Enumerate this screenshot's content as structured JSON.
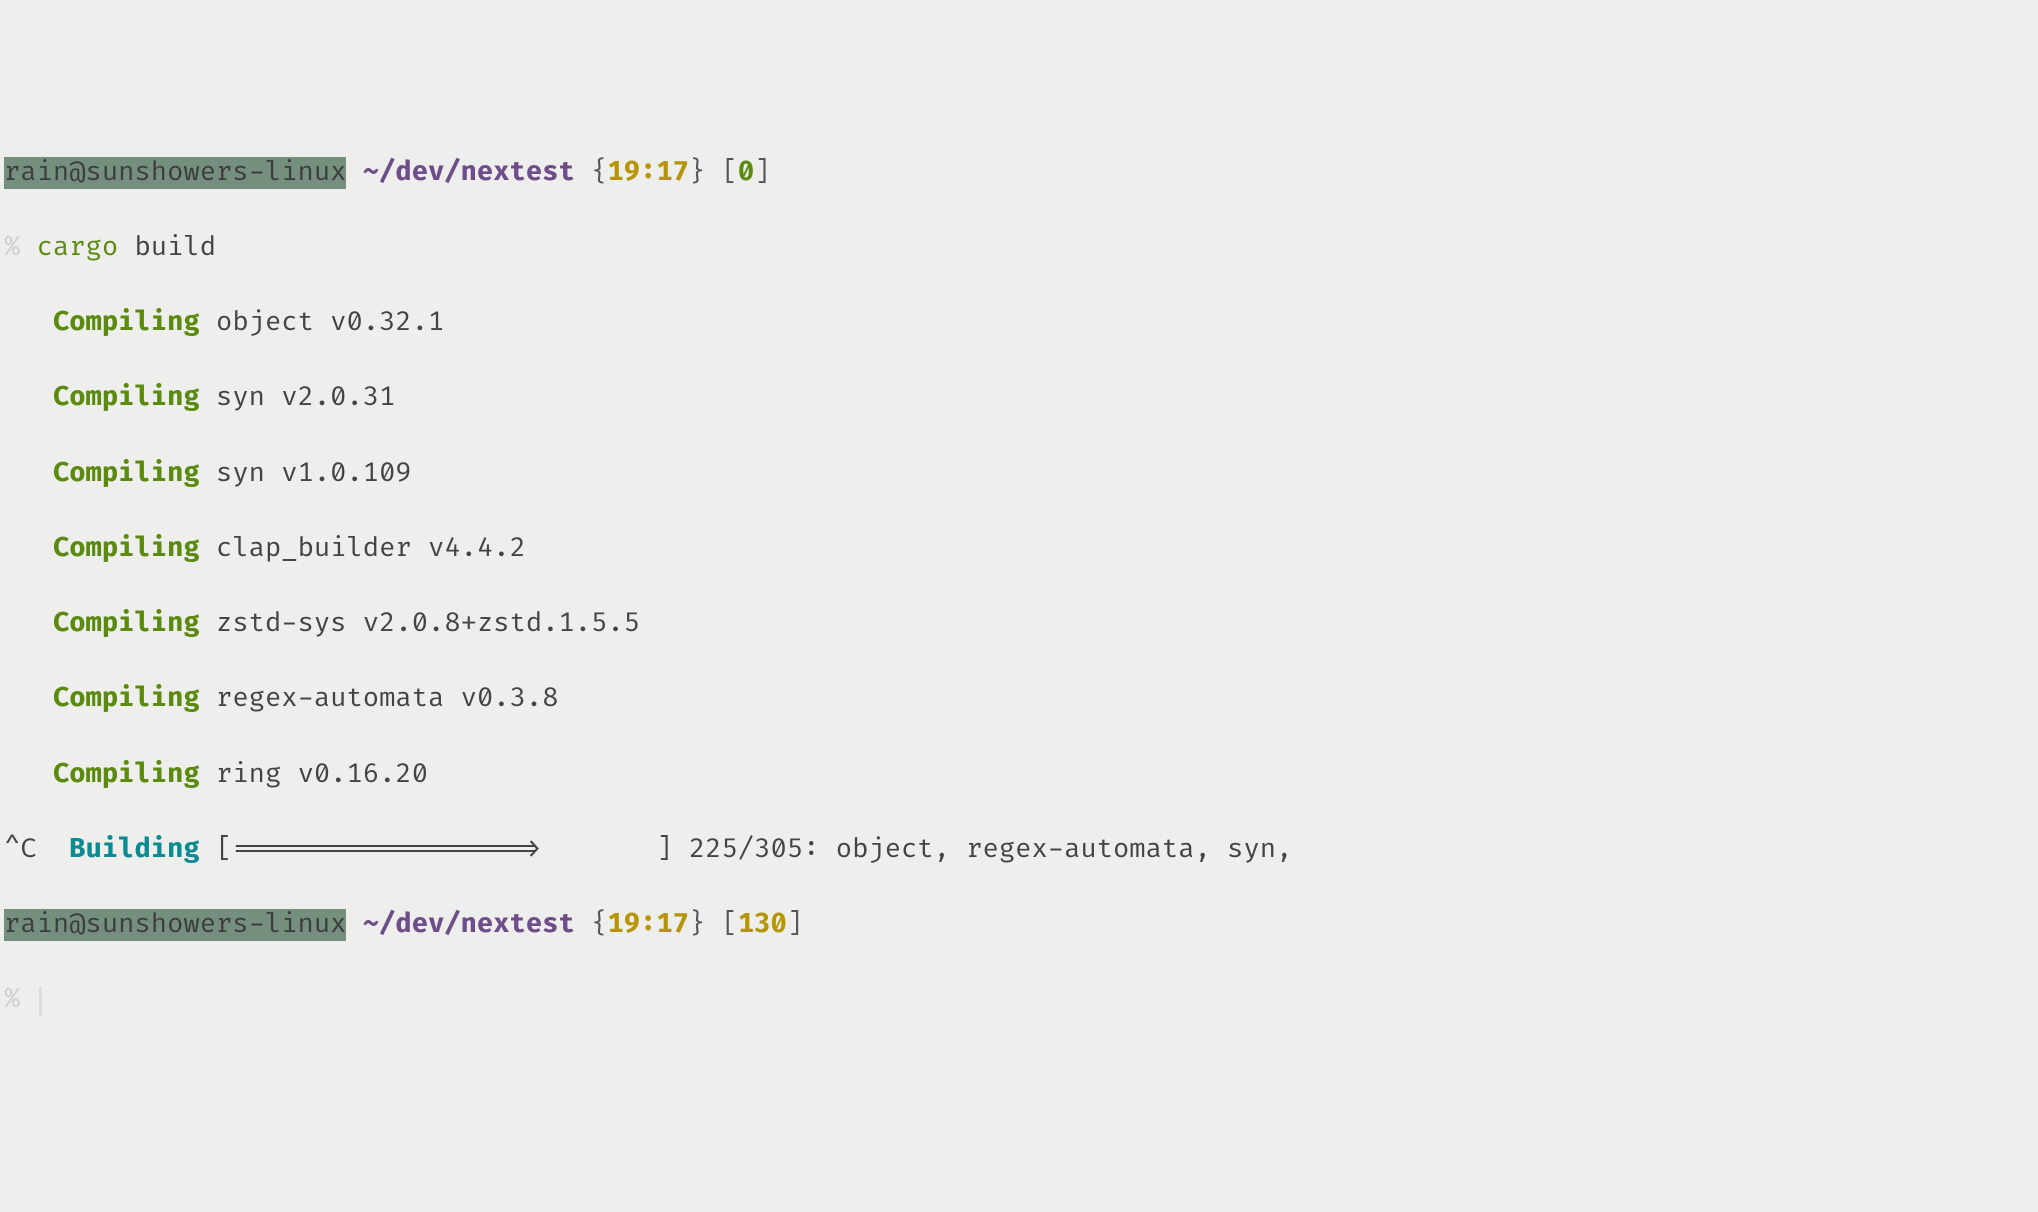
{
  "prompt1": {
    "userhost": "rain@sunshowers-linux",
    "path": "~/dev/nextest",
    "time": "19:17",
    "exit": "0"
  },
  "command": {
    "pct": "%",
    "cargo": "cargo",
    "args": "build"
  },
  "compile_verb": "Compiling",
  "compiles": [
    "object v0.32.1",
    "syn v2.0.31",
    "syn v1.0.109",
    "clap_builder v4.4.2",
    "zstd-sys v2.0.8+zstd.1.5.5",
    "regex-automata v0.3.8",
    "ring v0.16.20"
  ],
  "building": {
    "ctrlc": "^C",
    "verb": "Building",
    "bar_open": "[",
    "bar_fill": "==================>",
    "bar_space": "       ",
    "bar_close": "]",
    "progress": "225/305:",
    "tail": "object, regex-automata, syn,"
  },
  "prompt2": {
    "userhost": "rain@sunshowers-linux",
    "path": "~/dev/nextest",
    "time": "19:17",
    "exit": "130"
  },
  "prompt_empty": {
    "pct": "%"
  },
  "braces": {
    "open": "{",
    "close": "}"
  },
  "brackets": {
    "open": "[",
    "close": "]"
  }
}
